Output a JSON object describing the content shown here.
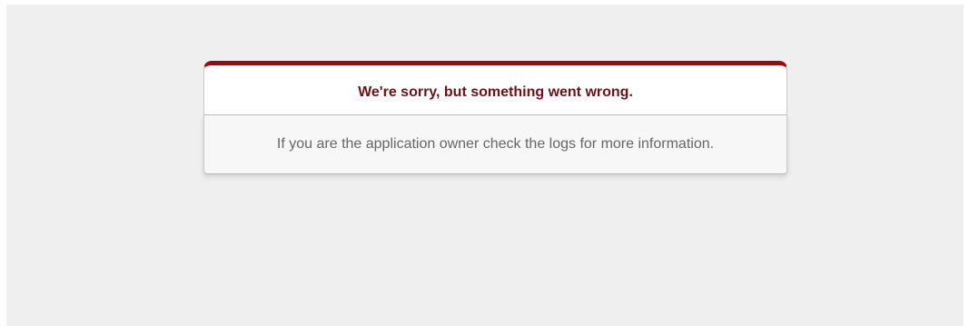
{
  "error": {
    "title": "We're sorry, but something went wrong.",
    "message": "If you are the application owner check the logs for more information."
  },
  "colors": {
    "accent": "#a40606",
    "title_text": "#730e15",
    "body_text": "#666666",
    "page_background": "#efefef",
    "card_background": "#ffffff",
    "message_background": "#f7f7f7"
  }
}
